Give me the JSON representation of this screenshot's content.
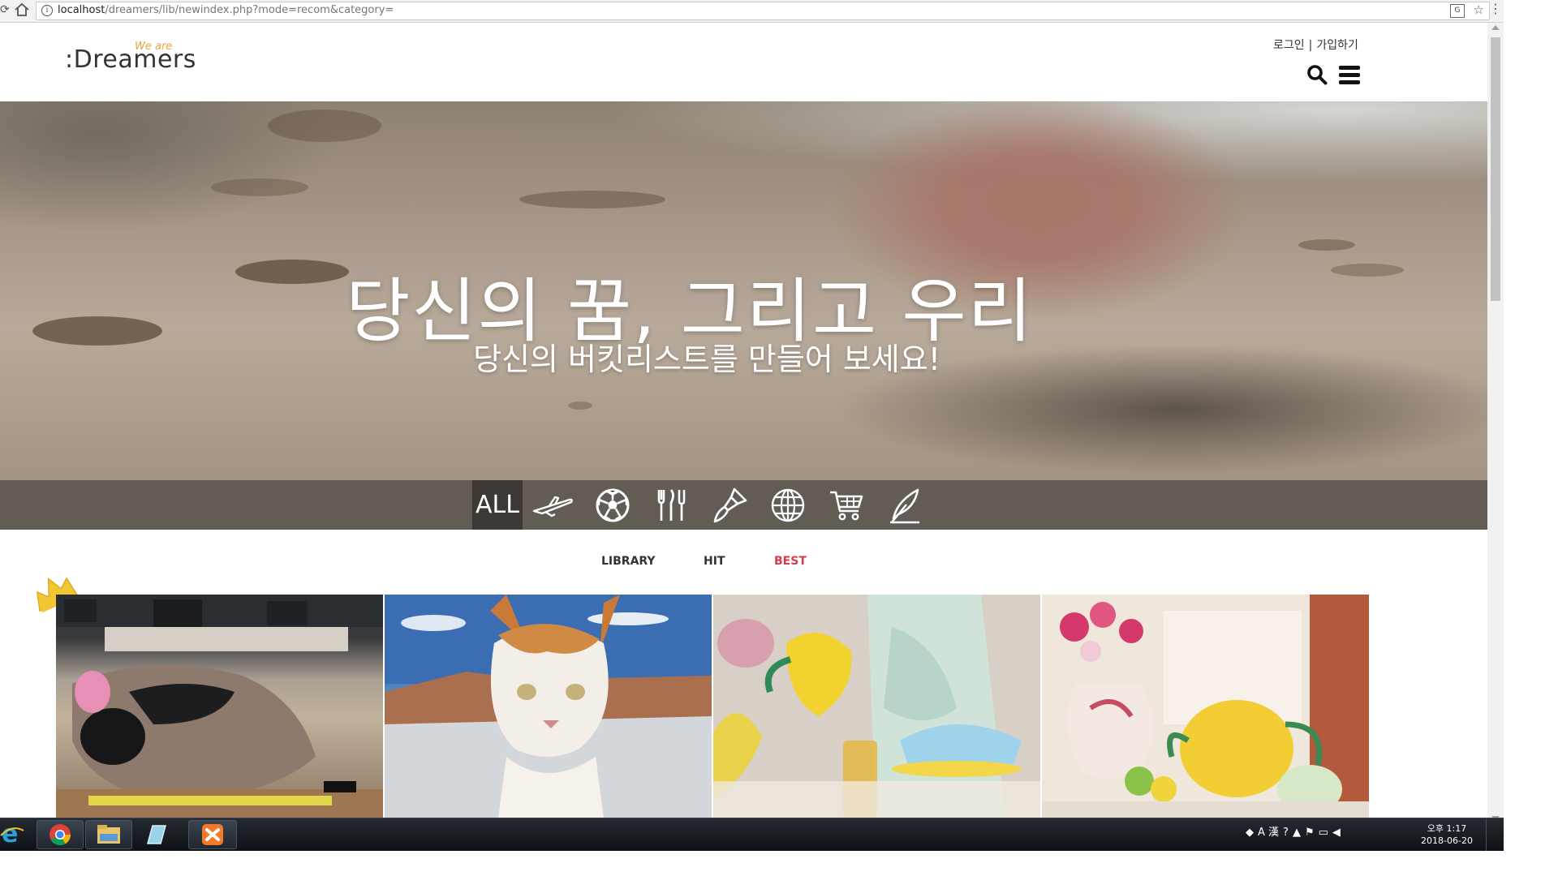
{
  "browser": {
    "url_host": "localhost",
    "url_path": "/dreamers/lib/newindex.php?mode=recom&category="
  },
  "header": {
    "logo_text": ":Dreamers",
    "logo_tagline": "We are",
    "login": "로그인",
    "separator": "|",
    "signup": "가입하기"
  },
  "hero": {
    "title": "당신의 꿈, 그리고 우리",
    "subtitle": "당신의 버킷리스트를 만들어 보세요!"
  },
  "categories": {
    "all_label": "ALL",
    "icons": [
      "airplane-icon",
      "soccer-ball-icon",
      "cutlery-icon",
      "paint-brush-icon",
      "globe-icon",
      "shopping-cart-icon",
      "feather-pen-icon"
    ],
    "active": "ALL"
  },
  "sort_tabs": {
    "library": "LIBRARY",
    "hit": "HIT",
    "best": "BEST",
    "active": "BEST",
    "active_color": "#d83a4a"
  },
  "gallery": {
    "items": [
      {
        "name": "sleeping-person-photo"
      },
      {
        "name": "cat-photo"
      },
      {
        "name": "lemonade-pouring-photo"
      },
      {
        "name": "teapot-flowers-photo"
      }
    ]
  },
  "taskbar": {
    "apps": [
      "internet-explorer-icon",
      "chrome-icon",
      "file-explorer-icon",
      "notepad-icon",
      "xampp-icon"
    ],
    "ime": "A 漢",
    "clock_time": "오후 1:17",
    "clock_date": "2018-06-20"
  }
}
